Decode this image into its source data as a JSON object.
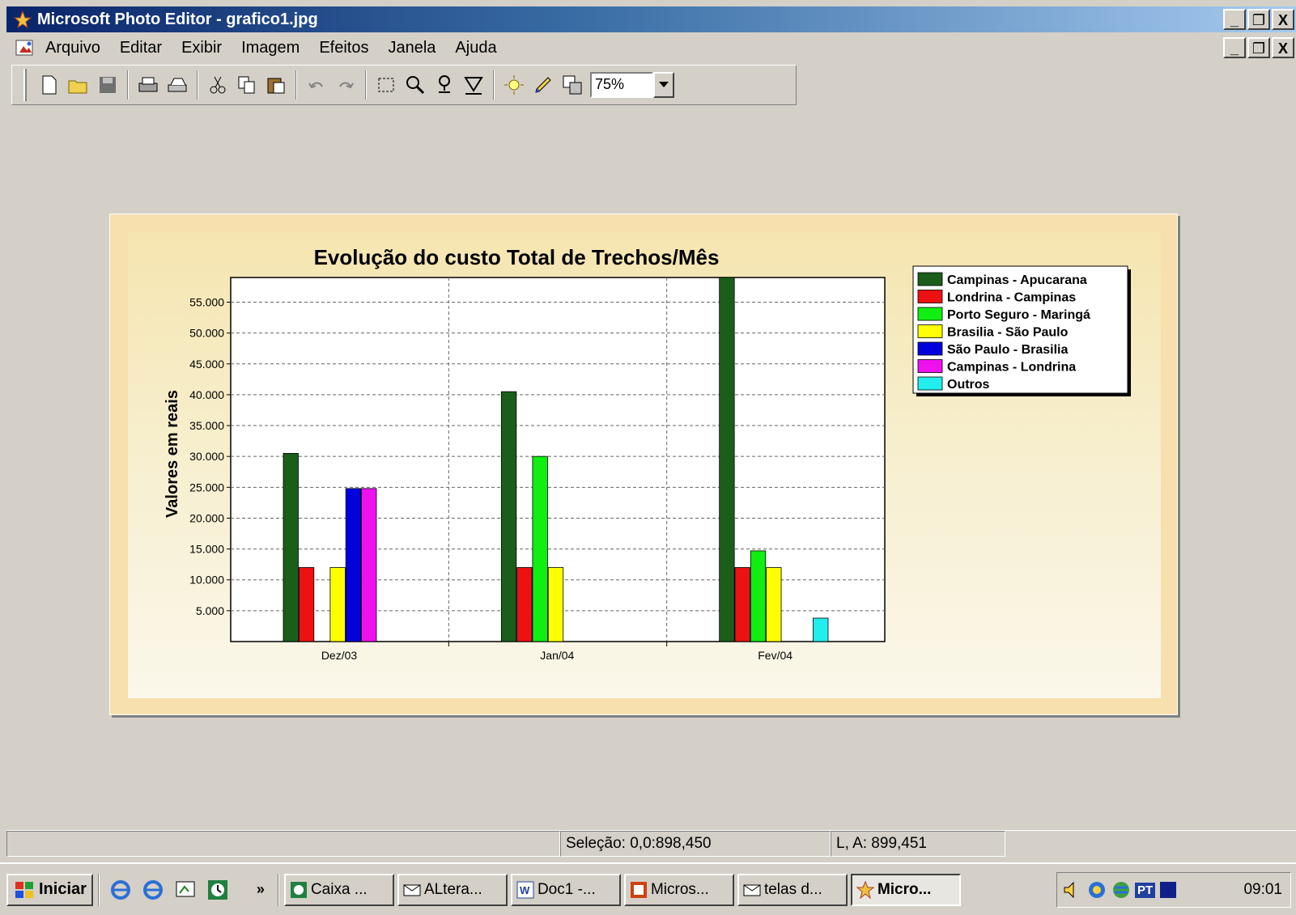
{
  "window": {
    "title": "Microsoft Photo Editor - grafico1.jpg",
    "controls": [
      "_",
      "ّ",
      "X"
    ]
  },
  "menu": [
    "Arquivo",
    "Editar",
    "Exibir",
    "Imagem",
    "Efeitos",
    "Janela",
    "Ajuda"
  ],
  "toolbar": {
    "zoom_value": "75%",
    "icons": [
      "new-icon",
      "open-icon",
      "save-icon",
      "print-icon",
      "scan-icon",
      "cut-icon",
      "copy-icon",
      "paste-icon",
      "undo-icon",
      "redo-icon",
      "select-icon",
      "zoom-icon",
      "smudge-icon",
      "paint-icon",
      "balance-icon",
      "color-icon",
      "properties-icon"
    ]
  },
  "status": {
    "selection": "Seleção: 0,0:898,450",
    "size": "L, A: 899,451"
  },
  "taskbar": {
    "start": "Iniciar",
    "chevron": "»",
    "tasks": [
      "Caixa ...",
      "ALtera...",
      "Doc1 -...",
      "Micros...",
      "telas d...",
      "Micro..."
    ],
    "tray_lang": "PT",
    "clock": "09:01"
  },
  "colors": {
    "titlebar_start": "#0a246a",
    "titlebar_end": "#a6caf0",
    "face": "#d4d0c8",
    "frame": "#f7dfae"
  },
  "chart_data": {
    "type": "bar",
    "title": "Evolução do custo Total de Trechos/Mês",
    "ylabel": "Valores em reais",
    "xlabel": "",
    "categories": [
      "Dez/03",
      "Jan/04",
      "Fev/04"
    ],
    "ylim": [
      0,
      59000
    ],
    "yticks": [
      5000,
      10000,
      15000,
      20000,
      25000,
      30000,
      35000,
      40000,
      45000,
      50000,
      55000
    ],
    "ytick_labels": [
      "5.000",
      "10.000",
      "15.000",
      "20.000",
      "25.000",
      "30.000",
      "35.000",
      "40.000",
      "45.000",
      "50.000",
      "55.000"
    ],
    "grid": true,
    "legend_position": "right",
    "series": [
      {
        "name": "Campinas - Apucarana",
        "color": "#1a5e1a",
        "values": [
          30500,
          40500,
          59000
        ]
      },
      {
        "name": "Londrina - Campinas",
        "color": "#ee1111",
        "values": [
          12000,
          12000,
          12000
        ]
      },
      {
        "name": "Porto Seguro - Maringá",
        "color": "#11ee11",
        "values": [
          0,
          30000,
          14700
        ]
      },
      {
        "name": "Brasilia - São Paulo",
        "color": "#ffff00",
        "values": [
          12000,
          12000,
          12000
        ]
      },
      {
        "name": "São Paulo - Brasilia",
        "color": "#0000dd",
        "values": [
          24800,
          0,
          0
        ]
      },
      {
        "name": "Campinas - Londrina",
        "color": "#ee11ee",
        "values": [
          24800,
          0,
          0
        ]
      },
      {
        "name": "Outros",
        "color": "#22eeee",
        "values": [
          0,
          0,
          3800
        ]
      }
    ]
  }
}
